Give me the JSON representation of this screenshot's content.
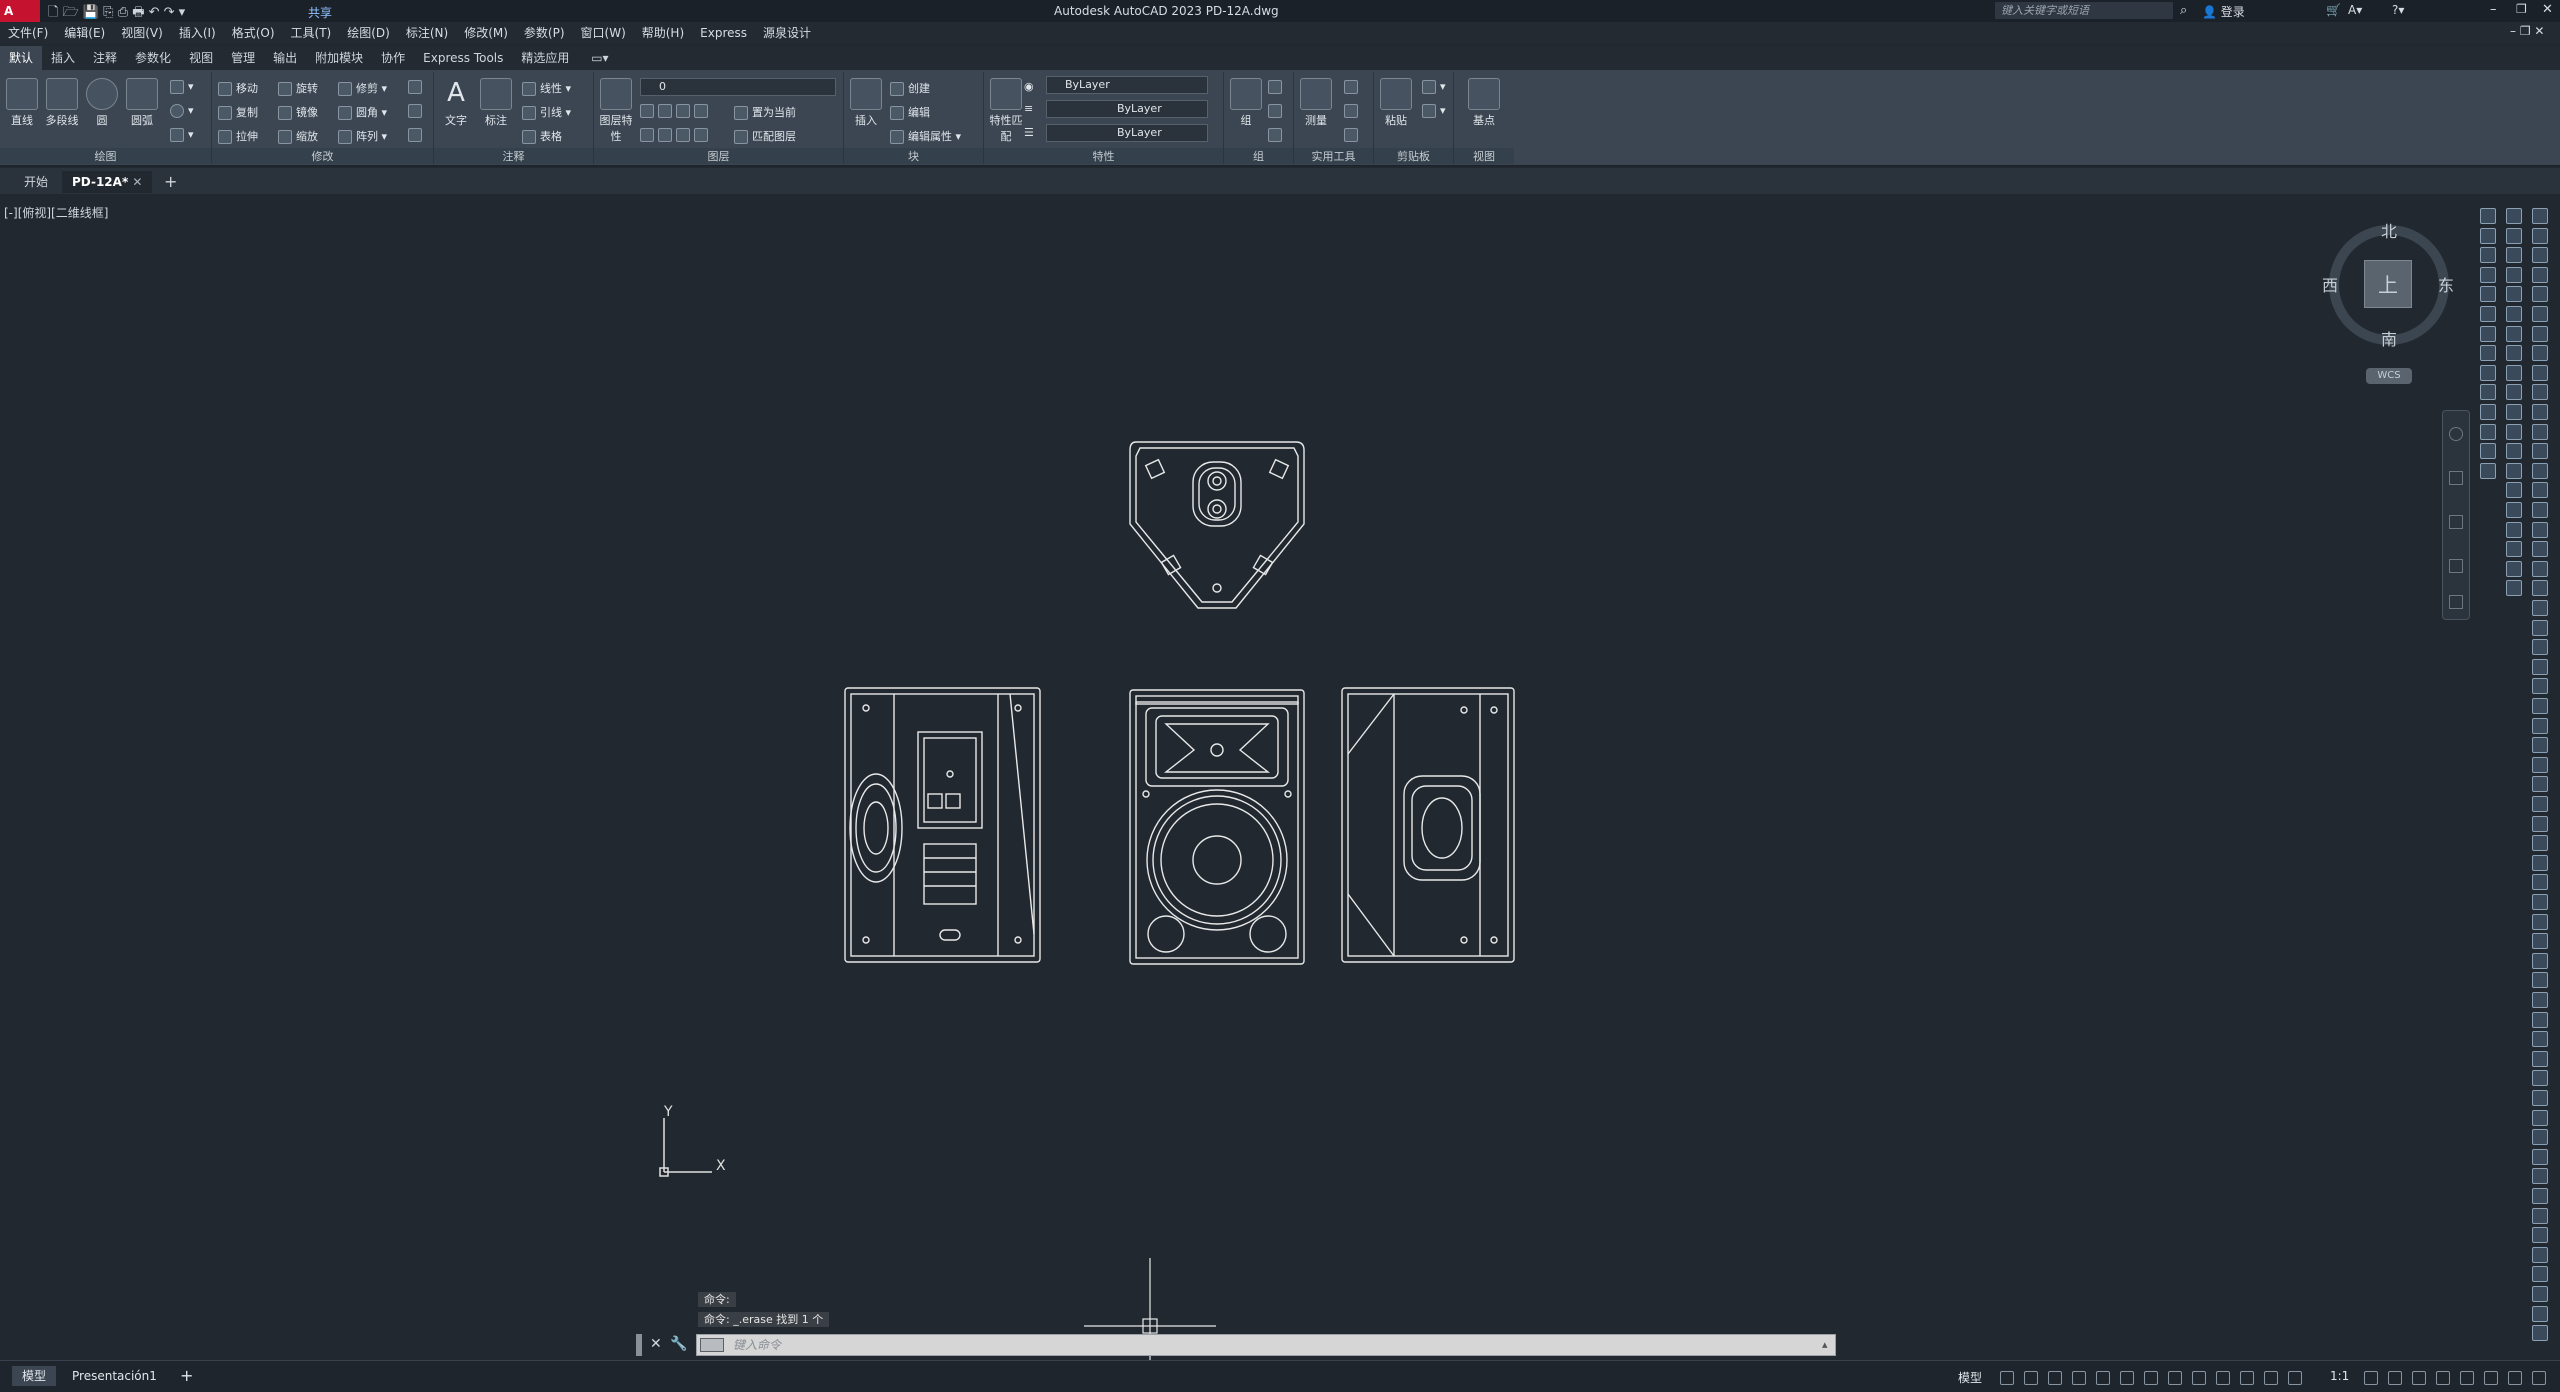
{
  "app": {
    "logo_text": "A CAD",
    "title": "Autodesk AutoCAD 2023    PD-12A.dwg",
    "share_label": "共享",
    "search_placeholder": "键入关键字或短语",
    "login_label": "登录"
  },
  "menu": [
    "文件(F)",
    "编辑(E)",
    "视图(V)",
    "插入(I)",
    "格式(O)",
    "工具(T)",
    "绘图(D)",
    "标注(N)",
    "修改(M)",
    "参数(P)",
    "窗口(W)",
    "帮助(H)",
    "Express",
    "源泉设计"
  ],
  "ribbon_tabs": [
    "默认",
    "插入",
    "注释",
    "参数化",
    "视图",
    "管理",
    "输出",
    "附加模块",
    "协作",
    "Express Tools",
    "精选应用"
  ],
  "ribbon": {
    "draw": {
      "title": "绘图",
      "line": "直线",
      "polyline": "多段线",
      "circle": "圆",
      "arc": "圆弧"
    },
    "modify": {
      "title": "修改",
      "move": "移动",
      "rotate": "旋转",
      "trim": "修剪",
      "copy": "复制",
      "mirror": "镜像",
      "fillet": "圆角",
      "stretch": "拉伸",
      "scale": "缩放",
      "array": "阵列"
    },
    "annotation": {
      "title": "注释",
      "text": "文字",
      "dimension": "标注",
      "linear": "线性",
      "leader": "引线",
      "table": "表格"
    },
    "layers": {
      "title": "图层",
      "properties": "图层特性",
      "current_layer": "0",
      "make_current": "置为当前",
      "match_layer": "匹配图层"
    },
    "block": {
      "title": "块",
      "insert": "插入",
      "create": "创建",
      "edit": "编辑",
      "edit_attr": "编辑属性"
    },
    "properties": {
      "title": "特性",
      "match": "特性匹配",
      "color": "ByLayer",
      "linetype": "ByLayer",
      "lineweight": "ByLayer"
    },
    "groups": {
      "title": "组",
      "group": "组"
    },
    "utilities": {
      "title": "实用工具",
      "measure": "测量"
    },
    "clipboard": {
      "title": "剪贴板",
      "paste": "粘贴"
    },
    "view": {
      "title": "视图",
      "base": "基点"
    }
  },
  "doc_tabs": {
    "start": "开始",
    "file": "PD-12A*"
  },
  "viewport": {
    "label": "[-][俯视][二维线框]"
  },
  "viewcube": {
    "north": "北",
    "south": "南",
    "east": "东",
    "west": "西",
    "top": "上",
    "wcs": "WCS"
  },
  "ucs": {
    "x": "X",
    "y": "Y"
  },
  "command": {
    "line1": "命令:",
    "line2": "命令: _.erase 找到 1 个",
    "placeholder": "键入命令"
  },
  "status": {
    "model_tab": "模型",
    "layout_tab": "Presentación1",
    "model_btn": "模型",
    "scale": "1:1"
  }
}
